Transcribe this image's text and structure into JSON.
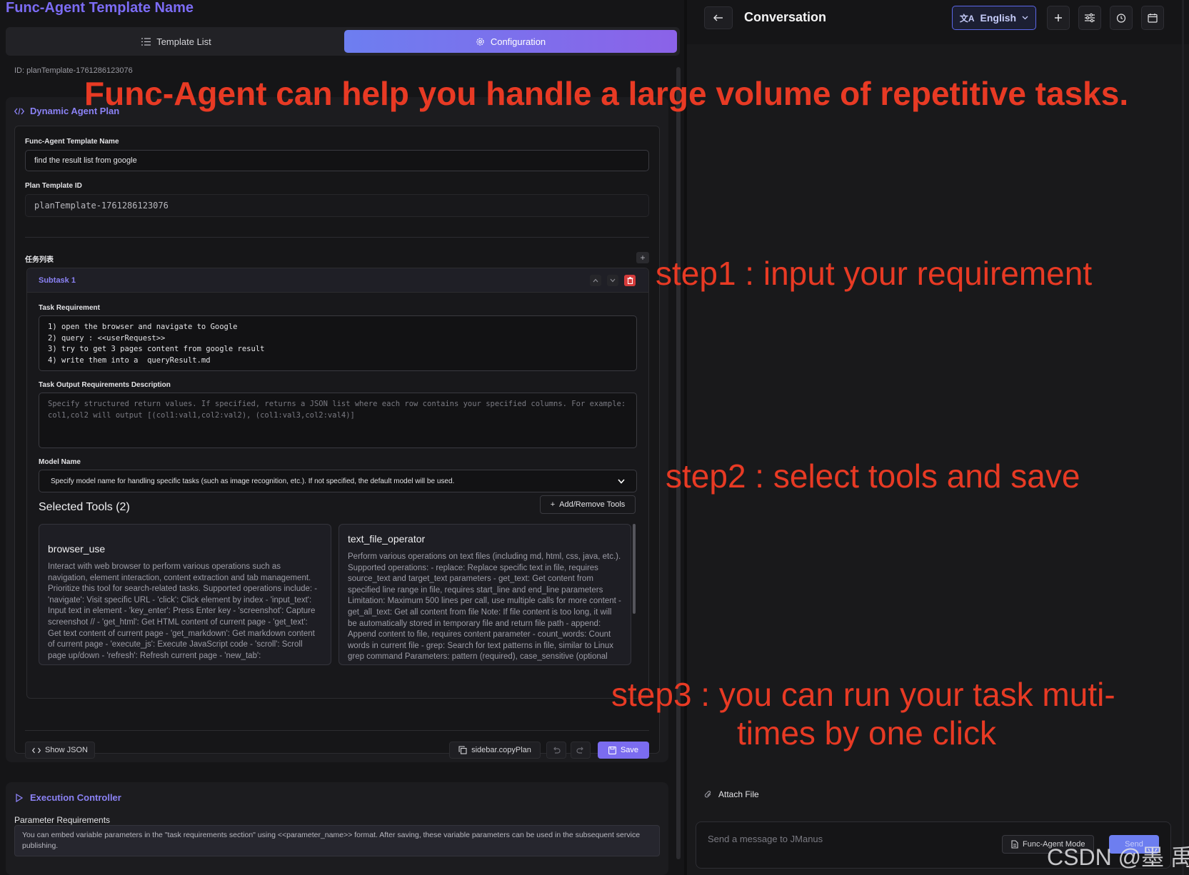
{
  "left": {
    "title": "Func-Agent Template Name",
    "tabs": [
      {
        "label": "Template List",
        "icon": "list-icon"
      },
      {
        "label": "Configuration",
        "icon": "gear-icon"
      }
    ],
    "id_line": "ID: planTemplate-1761286123076",
    "plan": {
      "heading": "Dynamic Agent Plan",
      "template_name_label": "Func-Agent Template Name",
      "template_name_value": "find the result list from google",
      "plan_id_label": "Plan Template ID",
      "plan_id_value": "planTemplate-1761286123076",
      "task_list_label": "任务列表",
      "add_label": "+",
      "subtask": {
        "title": "Subtask 1",
        "req_label": "Task Requirement",
        "req_value": "1) open the browser and navigate to Google\n2) query : <<userRequest>>\n3) try to get 3 pages content from google result\n4) write them into a  queryResult.md",
        "output_label": "Task Output Requirements Description",
        "output_placeholder": "Specify structured return values. If specified, returns a JSON list where each row contains your specified columns. For example: col1,col2 will output [(col1:val1,col2:val2), (col1:val3,col2:val4)]",
        "model_label": "Model Name",
        "model_value": "Specify model name for handling specific tasks (such as image recognition, etc.). If not specified, the default model will be used.",
        "tools_heading": "Selected Tools (2)",
        "add_remove_label": "Add/Remove Tools",
        "tools": [
          {
            "name": "browser_use",
            "desc": "Interact with web browser to perform various operations such as navigation, element interaction, content extraction and tab management. Prioritize this tool for search-related tasks. Supported operations include: - 'navigate': Visit specific URL - 'click': Click element by index - 'input_text': Input text in element - 'key_enter': Press Enter key - 'screenshot': Capture screenshot // - 'get_html': Get HTML content of current page - 'get_text': Get text content of current page - 'get_markdown': Get markdown content of current page - 'execute_js': Execute JavaScript code - 'scroll': Scroll page up/down - 'refresh': Refresh current page - 'new_tab':"
          },
          {
            "name": "text_file_operator",
            "desc": "Perform various operations on text files (including md, html, css, java, etc.). Supported operations: - replace: Replace specific text in file, requires source_text and target_text parameters - get_text: Get content from specified line range in file, requires start_line and end_line parameters Limitation: Maximum 500 lines per call, use multiple calls for more content - get_all_text: Get all content from file Note: If file content is too long, it will be automatically stored in temporary file and return file path - append: Append content to file, requires content parameter - count_words: Count words in current file - grep: Search for text patterns in file, similar to Linux grep command Parameters: pattern (required), case_sensitive (optional"
          }
        ]
      },
      "buttons": {
        "show_json": "Show JSON",
        "copy_plan": "sidebar.copyPlan",
        "save": "Save"
      }
    },
    "exec": {
      "heading": "Execution Controller",
      "param_label": "Parameter Requirements",
      "param_text": "You can embed variable parameters in the \"task requirements section\" using <<parameter_name>> format. After saving, these variable parameters can be used in the subsequent service publishing."
    }
  },
  "right": {
    "title": "Conversation",
    "language": "English",
    "attach_label": "Attach File",
    "message_placeholder": "Send a message to JManus",
    "mode_label": "Func-Agent Mode",
    "send_label": "Send"
  },
  "annotations": {
    "headline": "Func-Agent can help you handle a large volume of repetitive tasks.",
    "step1": "step1 : input your requirement",
    "step2": "step2 : select tools and save",
    "step3_line1": "step3 : you can run your task muti-",
    "step3_line2": "times by one click",
    "watermark": "CSDN @墨 禹"
  },
  "colors": {
    "accent": "#7b6cf0",
    "annotation": "#e83a24",
    "delete": "#d43b3b"
  }
}
